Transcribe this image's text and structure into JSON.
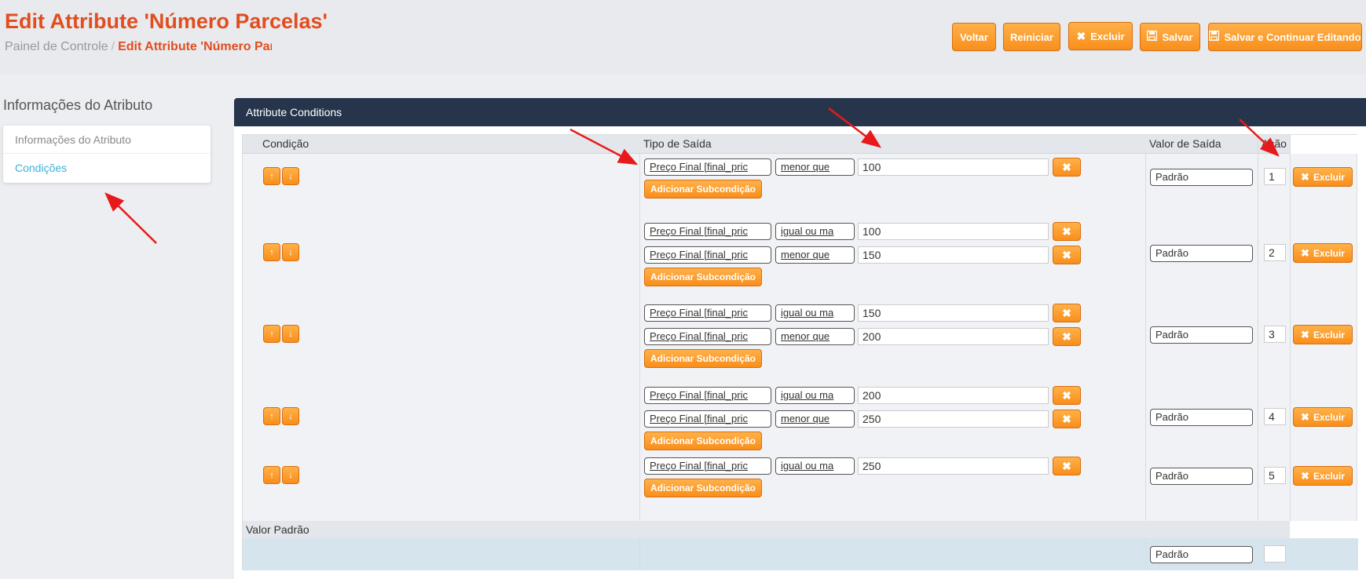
{
  "header": {
    "title": "Edit Attribute 'Número Parcelas'",
    "breadcrumb": {
      "home": "Painel de Controle",
      "separator": "/",
      "current": "Edit Attribute 'Número Parcelas'"
    },
    "buttons": {
      "back": "Voltar",
      "reset": "Reiniciar",
      "delete": "Excluir",
      "save": "Salvar",
      "save_continue": "Salvar e Continuar Editando"
    }
  },
  "sidebar": {
    "title": "Informações do Atributo",
    "items": [
      {
        "label": "Informações do Atributo",
        "active": false
      },
      {
        "label": "Condições",
        "active": true
      }
    ]
  },
  "panel": {
    "title": "Attribute Conditions",
    "columns": {
      "condition": "Condição",
      "output_type": "Tipo de Saída",
      "output_value": "Valor de Saída",
      "action": "Ação"
    },
    "add_subcondition_label": "Adicionar Subcondição",
    "delete_label": "Excluir",
    "rows": [
      {
        "subconditions": [
          {
            "field": "Preço Final [final_pric",
            "operator": "menor que",
            "value": "100"
          }
        ],
        "output": "Padrão",
        "sort": "1"
      },
      {
        "subconditions": [
          {
            "field": "Preço Final [final_pric",
            "operator": "igual ou ma",
            "value": "100"
          },
          {
            "field": "Preço Final [final_pric",
            "operator": "menor que",
            "value": "150"
          }
        ],
        "output": "Padrão",
        "sort": "2"
      },
      {
        "subconditions": [
          {
            "field": "Preço Final [final_pric",
            "operator": "igual ou ma",
            "value": "150"
          },
          {
            "field": "Preço Final [final_pric",
            "operator": "menor que",
            "value": "200"
          }
        ],
        "output": "Padrão",
        "sort": "3"
      },
      {
        "subconditions": [
          {
            "field": "Preço Final [final_pric",
            "operator": "igual ou ma",
            "value": "200"
          },
          {
            "field": "Preço Final [final_pric",
            "operator": "menor que",
            "value": "250"
          }
        ],
        "output": "Padrão",
        "sort": "4"
      },
      {
        "subconditions": [
          {
            "field": "Preço Final [final_pric",
            "operator": "igual ou ma",
            "value": "250"
          }
        ],
        "output": "Padrão",
        "sort": "5"
      }
    ],
    "default_row": {
      "label": "Valor Padrão",
      "output": "Padrão",
      "sort": ""
    }
  },
  "icons": {
    "delete": "times-icon",
    "save": "floppy-icon",
    "move_up": "arrow-up-icon",
    "move_down": "arrow-down-icon"
  },
  "colors": {
    "accent": "#f98e1a",
    "title": "#e24d1f",
    "panel_header": "#26354c",
    "link": "#3cb0d6",
    "annotation_arrow": "#e8191a"
  }
}
